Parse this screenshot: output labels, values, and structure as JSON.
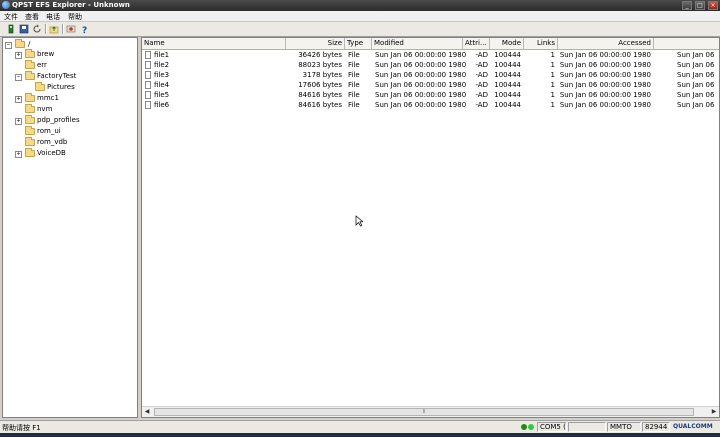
{
  "window": {
    "title": "QPST EFS Explorer - Unknown",
    "minimize_glyph": "_",
    "maximize_glyph": "□",
    "close_glyph": "×"
  },
  "menu": [
    "文件",
    "查看",
    "电话",
    "帮助"
  ],
  "toolbar": {
    "icons": [
      "phone-icon",
      "save-icon",
      "refresh-icon",
      "up-folder-icon",
      "properties-icon",
      "help-icon"
    ]
  },
  "tree": {
    "expand_glyph": "+",
    "collapse_glyph": "−",
    "items": [
      {
        "label": "/",
        "toggle": "−"
      },
      {
        "label": "brew",
        "toggle": "+"
      },
      {
        "label": "err",
        "toggle": ""
      },
      {
        "label": "FactoryTest",
        "toggle": "−"
      },
      {
        "label": "Pictures",
        "toggle": ""
      },
      {
        "label": "mmc1",
        "toggle": "+"
      },
      {
        "label": "nvm",
        "toggle": ""
      },
      {
        "label": "pdp_profiles",
        "toggle": "+"
      },
      {
        "label": "rom_ui",
        "toggle": ""
      },
      {
        "label": "rom_vdb",
        "toggle": ""
      },
      {
        "label": "VoiceDB",
        "toggle": "+"
      }
    ]
  },
  "list": {
    "columns": [
      "Name",
      "Size",
      "Type",
      "Modified",
      "Attri...",
      "Mode",
      "Links",
      "Accessed",
      ""
    ],
    "rows": [
      {
        "name": "file1",
        "size": "36426 bytes",
        "type": "File",
        "modified": "Sun Jan 06 00:00:00 1980",
        "attr": "-AD",
        "mode": "100444",
        "links": "1",
        "accessed": "Sun Jan 06 00:00:00 1980",
        "extra": "Sun Jan 06"
      },
      {
        "name": "file2",
        "size": "88023 bytes",
        "type": "File",
        "modified": "Sun Jan 06 00:00:00 1980",
        "attr": "-AD",
        "mode": "100444",
        "links": "1",
        "accessed": "Sun Jan 06 00:00:00 1980",
        "extra": "Sun Jan 06"
      },
      {
        "name": "file3",
        "size": "3178 bytes",
        "type": "File",
        "modified": "Sun Jan 06 00:00:00 1980",
        "attr": "-AD",
        "mode": "100444",
        "links": "1",
        "accessed": "Sun Jan 06 00:00:00 1980",
        "extra": "Sun Jan 06"
      },
      {
        "name": "file4",
        "size": "17606 bytes",
        "type": "File",
        "modified": "Sun Jan 06 00:00:00 1980",
        "attr": "-AD",
        "mode": "100444",
        "links": "1",
        "accessed": "Sun Jan 06 00:00:00 1980",
        "extra": "Sun Jan 06"
      },
      {
        "name": "file5",
        "size": "84616 bytes",
        "type": "File",
        "modified": "Sun Jan 06 00:00:00 1980",
        "attr": "-AD",
        "mode": "100444",
        "links": "1",
        "accessed": "Sun Jan 06 00:00:00 1980",
        "extra": "Sun Jan 06"
      },
      {
        "name": "file6",
        "size": "84616 bytes",
        "type": "File",
        "modified": "Sun Jan 06 00:00:00 1980",
        "attr": "-AD",
        "mode": "100444",
        "links": "1",
        "accessed": "Sun Jan 06 00:00:00 1980",
        "extra": "Sun Jan 06"
      }
    ]
  },
  "status": {
    "help_text": "帮助请按 F1",
    "port": "COM5 (",
    "mode": "MMTO",
    "number": "82944",
    "brand": "QUALCOMM",
    "led_colors": [
      "#1c8a1c",
      "#1c8a1c"
    ]
  }
}
